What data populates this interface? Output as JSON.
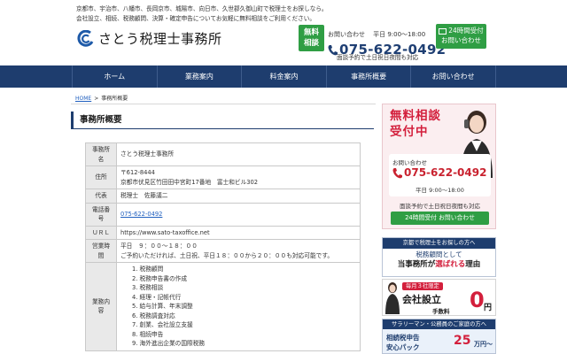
{
  "header": {
    "intro_line1": "京都市、宇治市、八幡市、長岡京市、城陽市、向日市、久世郡久御山町で税理士をお探しなら。",
    "intro_line2": "会社設立、相続、税務顧問、決算・確定申告についてお気軽に無料相談をご利用ください。",
    "logo_name": "さとう税理士事務所",
    "free_badge_l1": "無料",
    "free_badge_l2": "相談",
    "phone_label": "お問い合わせ",
    "phone_hours": "平日 9:00～18:00",
    "phone_number": "075-622-0492",
    "night_note": "面談予約で土日祝日夜間も対応",
    "contact_btn_l1": "24時間受付",
    "contact_btn_l2": "お問い合わせ",
    "accent_color": "#1e3d6e",
    "green_color": "#2f9e44"
  },
  "nav": {
    "items": [
      "ホーム",
      "業務案内",
      "料金案内",
      "事務所概要",
      "お問い合わせ"
    ]
  },
  "breadcrumb": {
    "home": "HOME",
    "sep": ">",
    "current": "事務所概要"
  },
  "page_title": "事務所概要",
  "office": {
    "name_label": "事務所名",
    "name": "さとう税理士事務所",
    "address_label": "住所",
    "postal": "〒612-8444",
    "address": "京都市伏見区竹田田中宮町17番地　富士和ビル302",
    "rep_label": "代表",
    "rep": "税理士　佐藤議二",
    "tel_label": "電話番号",
    "tel": "075-622-0492",
    "url_label": "ＵＲＬ",
    "url": "https://www.sato-taxoffice.net",
    "hours_label": "営業時間",
    "hours_l1": "平日　９：００～１８：００",
    "hours_l2": "ご予約いただければ、土日祝、平日１８：００から２０：００も対応可能です。",
    "services_label": "業務内容",
    "services": [
      "1. 税務顧問",
      "2. 税務申告書の作成",
      "3. 税務相談",
      "4. 経理・記帳代行",
      "5. 給与計算、年末調整",
      "6. 税務調査対応",
      "7. 創業、会社設立支援",
      "8. 相続申告",
      "9. 海外進出企業の国際税務"
    ]
  },
  "sidebar": {
    "consult_title_l1": "無料相談",
    "consult_title_l2": "受付中",
    "consult_label": "お問い合わせ",
    "consult_phone": "075-622-0492",
    "consult_hours": "平日 9:00～18:00",
    "consult_night": "面談予約で土日祝日夜間も対応",
    "consult_btn": "24時間受付 お問い合わせ",
    "advisor_top": "京都で税理士をお探しの方へ",
    "advisor_mid": "税務顧問として",
    "advisor_bot_a": "当事務所が",
    "advisor_bot_red": "選ばれる",
    "advisor_bot_b": "理由",
    "setup_tag": "毎月３社限定",
    "setup_main": "会社設立",
    "setup_fee": "手数料",
    "setup_zero": "0",
    "setup_yen": "円",
    "salary_top": "サラリーマン・公務員のご家庭の方へ",
    "salary_l1": "相続税申告",
    "salary_l2": "安心パック",
    "salary_price": "25",
    "salary_unit": "万円～",
    "red_color": "#d31f3c"
  }
}
